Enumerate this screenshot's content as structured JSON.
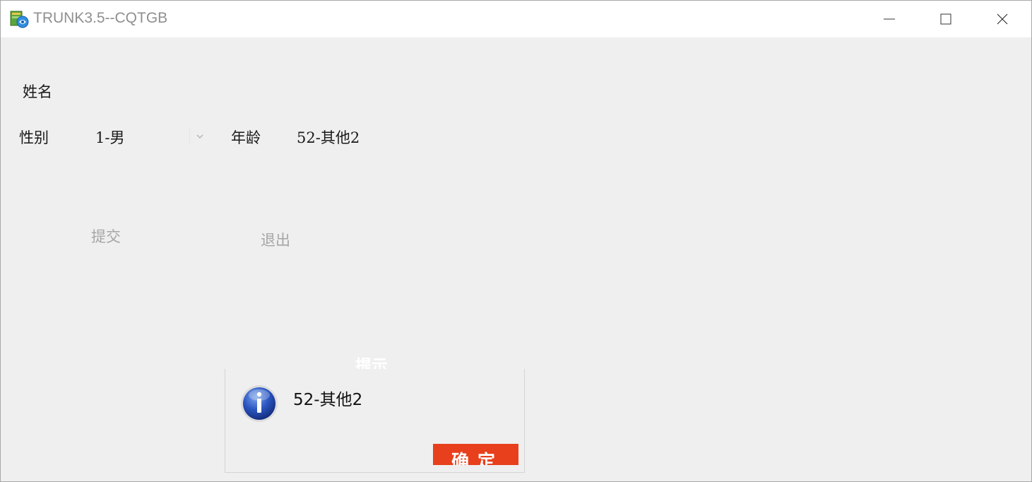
{
  "window": {
    "title": "TRUNK3.5--CQTGB",
    "icon": "app-icon",
    "controls": [
      "minimize-icon",
      "maximize-icon",
      "close-icon"
    ]
  },
  "form": {
    "name_label": "姓名",
    "gender_label": "性别",
    "gender_value": "1-男",
    "age_label": "年龄",
    "age_value": "52-其他2",
    "submit_label": "提交",
    "exit_label": "退出"
  },
  "dialog": {
    "title": "提示",
    "icon": "info-icon",
    "message": "52-其他2",
    "ok_label": "确定",
    "ok_color": "#e8401c"
  }
}
